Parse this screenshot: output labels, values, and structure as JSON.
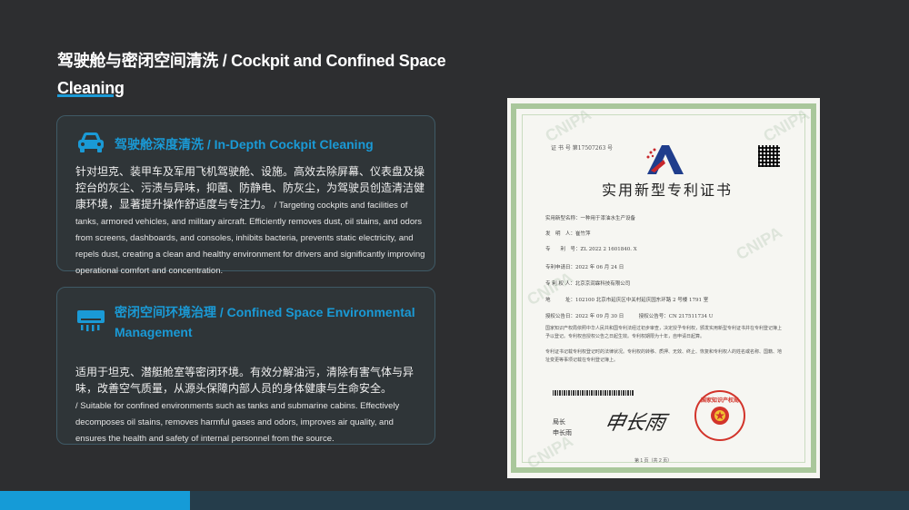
{
  "page": {
    "title": "驾驶舱与密闭空间清洗 / Cockpit and Confined Space Cleaning"
  },
  "cards": [
    {
      "heading": "驾驶舱深度清洗 / In-Depth Cockpit Cleaning",
      "icon": "car-icon",
      "zh": "针对坦克、装甲车及军用飞机驾驶舱、设施。高效去除屏幕、仪表盘及操控台的灰尘、污渍与异味，抑菌、防静电、防灰尘，为驾驶员创造清洁健康环境，显著提升操作舒适度与专注力。",
      "en": " / Targeting cockpits and facilities of tanks, armored vehicles, and military aircraft. Efficiently removes dust, oil stains, and odors from screens, dashboards, and consoles, inhibits bacteria, prevents static electricity, and repels dust, creating a clean and healthy environment for drivers and significantly improving operational comfort and concentration."
    },
    {
      "heading": "密闭空间环境治理 / Confined Space Environmental Management",
      "icon": "air-conditioner-icon",
      "zh": "适用于坦克、潜艇舱室等密闭环境。有效分解油污，清除有害气体与异味，改善空气质量，从源头保障内部人员的身体健康与生命安全。",
      "en": "/ Suitable for confined environments such as tanks and submarine cabins. Effectively decomposes oil stains, removes harmful gases and odors, improves air quality, and ensures the health and safety of internal personnel from the source."
    }
  ],
  "certificate": {
    "serial": "证 书 号 第17507263 号",
    "title": "实用新型专利证书",
    "rows": [
      "实用新型名称：一种用于漆油水生产设备",
      "发　明　人：崔竹萍",
      "专　　利　号：ZL 2022 2 1601840. X",
      "专利申请日：2022 年 06 月 24 日",
      "专 利 权 人：北京京润霖科技有限公司",
      "地　　　址：102100 北京市延庆区中关村延庆园东环路 2 号楼 1791 室",
      "授权公告日：2022 年 09 月 30 日　　　授权公告号：CN 217511734 U"
    ],
    "para1": "国家知识产权局依照中华人民共和国专利法经过初步审查，决定授予专利权，颁发实用新型专利证书并在专利登记簿上予以登记。专利权自授权公告之日起生效。专利权期限为十年，自申请日起算。",
    "para2": "专利证书记载专利权登记时的法律状况。专利权的转移、质押、无效、终止、恢复和专利权人的姓名或名称、国籍、地址变更等事项记载在专利登记簿上。",
    "director_label": "局长",
    "director_label2": "申长雨",
    "signature": "申长雨",
    "page_no": "第 1 页（共 2 页）",
    "watermark": "CNIPA",
    "seal_text": "国家知识产权局"
  },
  "colors": {
    "background": "#2d2e30",
    "accent": "#1a9ad6",
    "bottom_bar": "#253d4b"
  }
}
